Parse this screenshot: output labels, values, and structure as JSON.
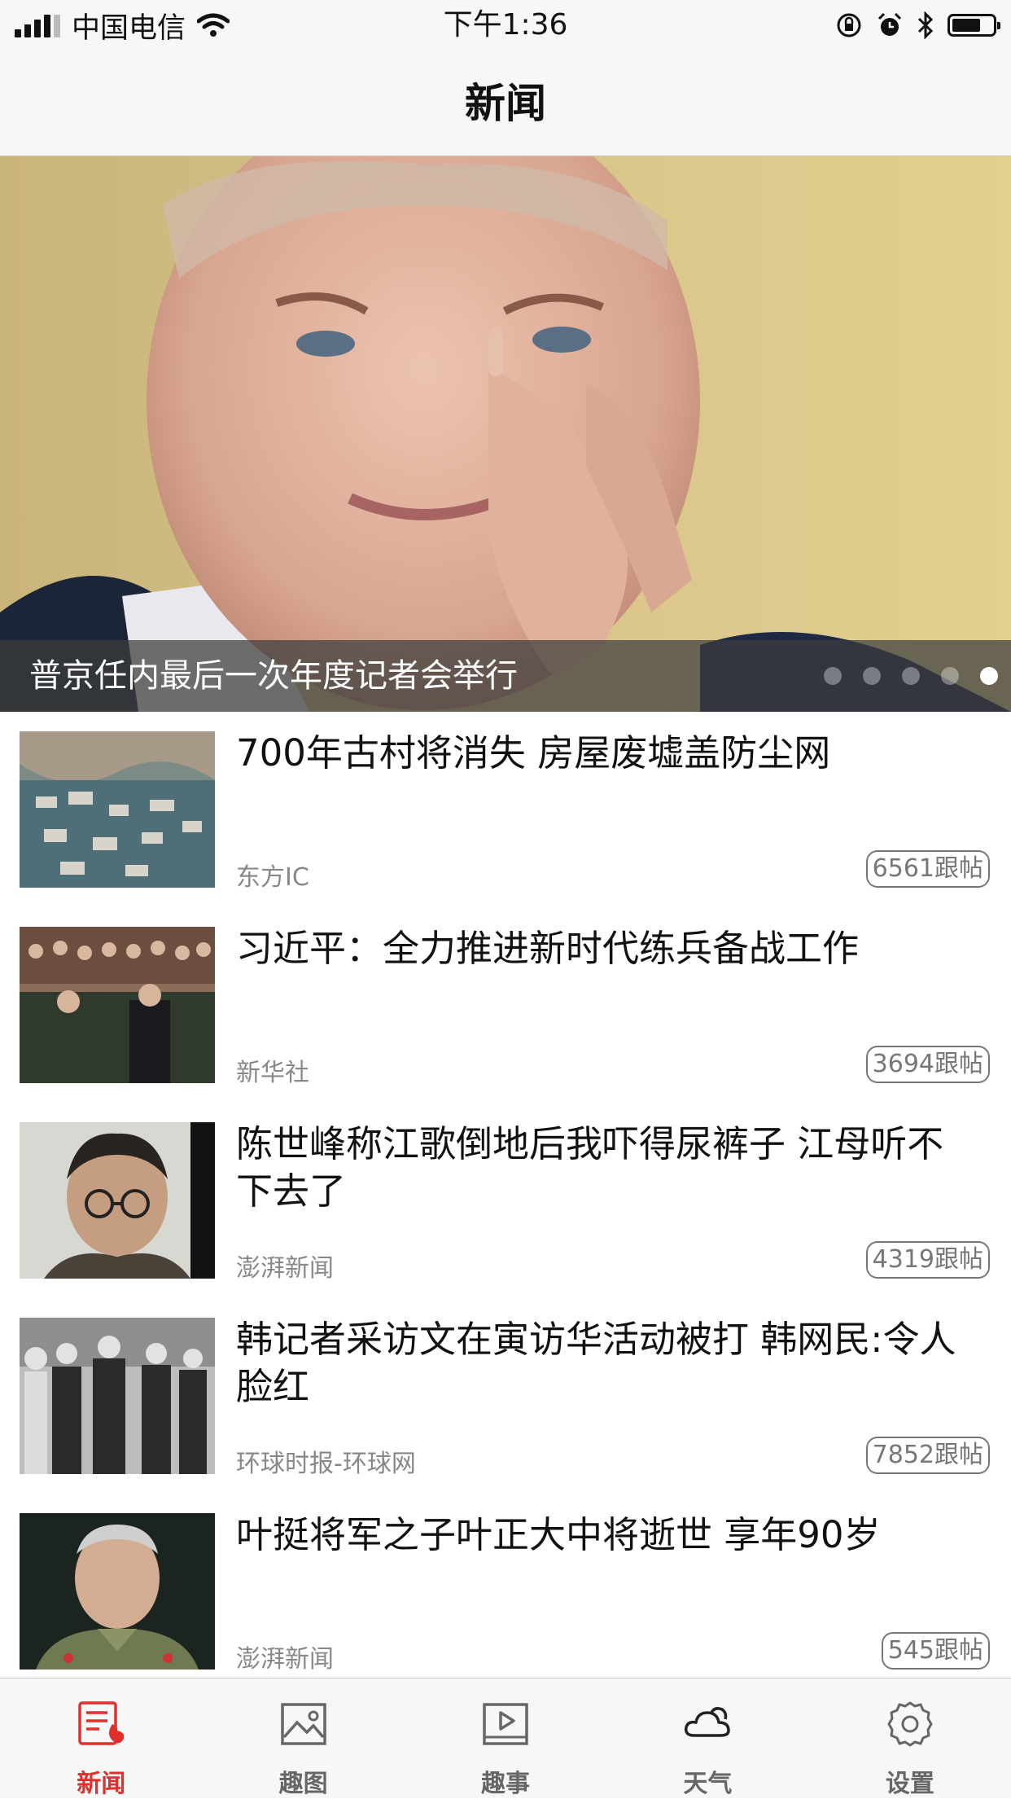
{
  "status_bar": {
    "carrier": "中国电信",
    "time": "下午1:36",
    "battery_level": 0.7
  },
  "nav": {
    "title": "新闻"
  },
  "hero": {
    "caption": "普京任内最后一次年度记者会举行",
    "page_count": 5,
    "active_page": 5
  },
  "news": [
    {
      "title": "700年古村将消失 房屋废墟盖防尘网",
      "source": "东方IC",
      "comments": "6561跟帖"
    },
    {
      "title": "习近平：全力推进新时代练兵备战工作",
      "source": "新华社",
      "comments": "3694跟帖"
    },
    {
      "title": "陈世峰称江歌倒地后我吓得尿裤子 江母听不下去了",
      "source": "澎湃新闻",
      "comments": "4319跟帖"
    },
    {
      "title": "韩记者采访文在寅访华活动被打 韩网民:令人脸红",
      "source": "环球时报-环球网",
      "comments": "7852跟帖"
    },
    {
      "title": "叶挺将军之子叶正大中将逝世 享年90岁",
      "source": "澎湃新闻",
      "comments": "545跟帖"
    }
  ],
  "tabs": [
    {
      "label": "新闻",
      "icon": "news-icon",
      "active": true
    },
    {
      "label": "趣图",
      "icon": "picture-icon",
      "active": false
    },
    {
      "label": "趣事",
      "icon": "video-icon",
      "active": false
    },
    {
      "label": "天气",
      "icon": "cloud-icon",
      "active": false
    },
    {
      "label": "设置",
      "icon": "gear-icon",
      "active": false
    }
  ],
  "colors": {
    "accent": "#e0302e",
    "bar_bg": "#f7f7f7"
  }
}
